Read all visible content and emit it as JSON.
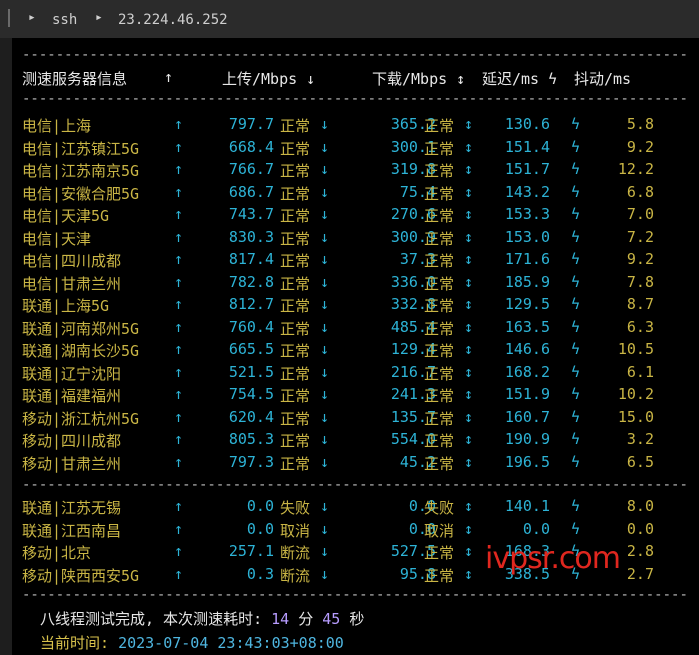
{
  "tab": {
    "arrow1": "▸",
    "title": "ssh",
    "arrow2": "▸",
    "host": "23.224.46.252"
  },
  "dash": "------------------------------------------------------------------------------------------------------------------------------------------------------",
  "header": {
    "col1": "测速服务器信息",
    "col1_arrow": "↑",
    "col2": "上传/Mbps ↓",
    "col3": "下载/Mbps ↕",
    "col4": "延迟/ms ϟ",
    "col5": "抖动/ms"
  },
  "arrows": {
    "a1": "↑",
    "a2": "↓",
    "a3": "↕",
    "bolt": "ϟ"
  },
  "rows1": [
    {
      "name": "电信|上海",
      "up": "797.7",
      "us": "正常",
      "dn": "365.2",
      "ds": "正常",
      "lat": "130.6",
      "jit": "5.8"
    },
    {
      "name": "电信|江苏镇江5G",
      "up": "668.4",
      "us": "正常",
      "dn": "300.1",
      "ds": "正常",
      "lat": "151.4",
      "jit": "9.2"
    },
    {
      "name": "电信|江苏南京5G",
      "up": "766.7",
      "us": "正常",
      "dn": "319.8",
      "ds": "正常",
      "lat": "151.7",
      "jit": "12.2"
    },
    {
      "name": "电信|安徽合肥5G",
      "up": "686.7",
      "us": "正常",
      "dn": "75.4",
      "ds": "正常",
      "lat": "143.2",
      "jit": "6.8"
    },
    {
      "name": "电信|天津5G",
      "up": "743.7",
      "us": "正常",
      "dn": "270.6",
      "ds": "正常",
      "lat": "153.3",
      "jit": "7.0"
    },
    {
      "name": "电信|天津",
      "up": "830.3",
      "us": "正常",
      "dn": "300.9",
      "ds": "正常",
      "lat": "153.0",
      "jit": "7.2"
    },
    {
      "name": "电信|四川成都",
      "up": "817.4",
      "us": "正常",
      "dn": "37.3",
      "ds": "正常",
      "lat": "171.6",
      "jit": "9.2"
    },
    {
      "name": "电信|甘肃兰州",
      "up": "782.8",
      "us": "正常",
      "dn": "336.0",
      "ds": "正常",
      "lat": "185.9",
      "jit": "7.8"
    },
    {
      "name": "联通|上海5G",
      "up": "812.7",
      "us": "正常",
      "dn": "332.8",
      "ds": "正常",
      "lat": "129.5",
      "jit": "8.7"
    },
    {
      "name": "联通|河南郑州5G",
      "up": "760.4",
      "us": "正常",
      "dn": "485.4",
      "ds": "正常",
      "lat": "163.5",
      "jit": "6.3"
    },
    {
      "name": "联通|湖南长沙5G",
      "up": "665.5",
      "us": "正常",
      "dn": "129.4",
      "ds": "正常",
      "lat": "146.6",
      "jit": "10.5"
    },
    {
      "name": "联通|辽宁沈阳",
      "up": "521.5",
      "us": "正常",
      "dn": "216.7",
      "ds": "正常",
      "lat": "168.2",
      "jit": "6.1"
    },
    {
      "name": "联通|福建福州",
      "up": "754.5",
      "us": "正常",
      "dn": "241.3",
      "ds": "正常",
      "lat": "151.9",
      "jit": "10.2"
    },
    {
      "name": "移动|浙江杭州5G",
      "up": "620.4",
      "us": "正常",
      "dn": "135.7",
      "ds": "正常",
      "lat": "160.7",
      "jit": "15.0"
    },
    {
      "name": "移动|四川成都",
      "up": "805.3",
      "us": "正常",
      "dn": "554.0",
      "ds": "正常",
      "lat": "190.9",
      "jit": "3.2"
    },
    {
      "name": "移动|甘肃兰州",
      "up": "797.3",
      "us": "正常",
      "dn": "45.2",
      "ds": "正常",
      "lat": "196.5",
      "jit": "6.5"
    }
  ],
  "rows2": [
    {
      "name": "联通|江苏无锡",
      "up": "0.0",
      "us": "失败",
      "dn": "0.0",
      "ds": "失败",
      "lat": "140.1",
      "jit": "8.0"
    },
    {
      "name": "联通|江西南昌",
      "up": "0.0",
      "us": "取消",
      "dn": "0.0",
      "ds": "取消",
      "lat": "0.0",
      "jit": "0.0"
    },
    {
      "name": "移动|北京",
      "up": "257.1",
      "us": "断流",
      "dn": "527.5",
      "ds": "正常",
      "lat": "168.3",
      "jit": "2.8"
    },
    {
      "name": "移动|陕西西安5G",
      "up": "0.3",
      "us": "断流",
      "dn": "95.8",
      "ds": "正常",
      "lat": "338.5",
      "jit": "2.7"
    }
  ],
  "footer": {
    "line1_prefix": "八线程测试完成, 本次测速耗时: ",
    "minutes": "14",
    "min_label": " 分 ",
    "seconds": "45",
    "sec_label": " 秒",
    "line2_prefix": "当前时间: ",
    "time": "2023-07-04 23:43:03+08:00"
  },
  "watermark": "ivpsr.com"
}
